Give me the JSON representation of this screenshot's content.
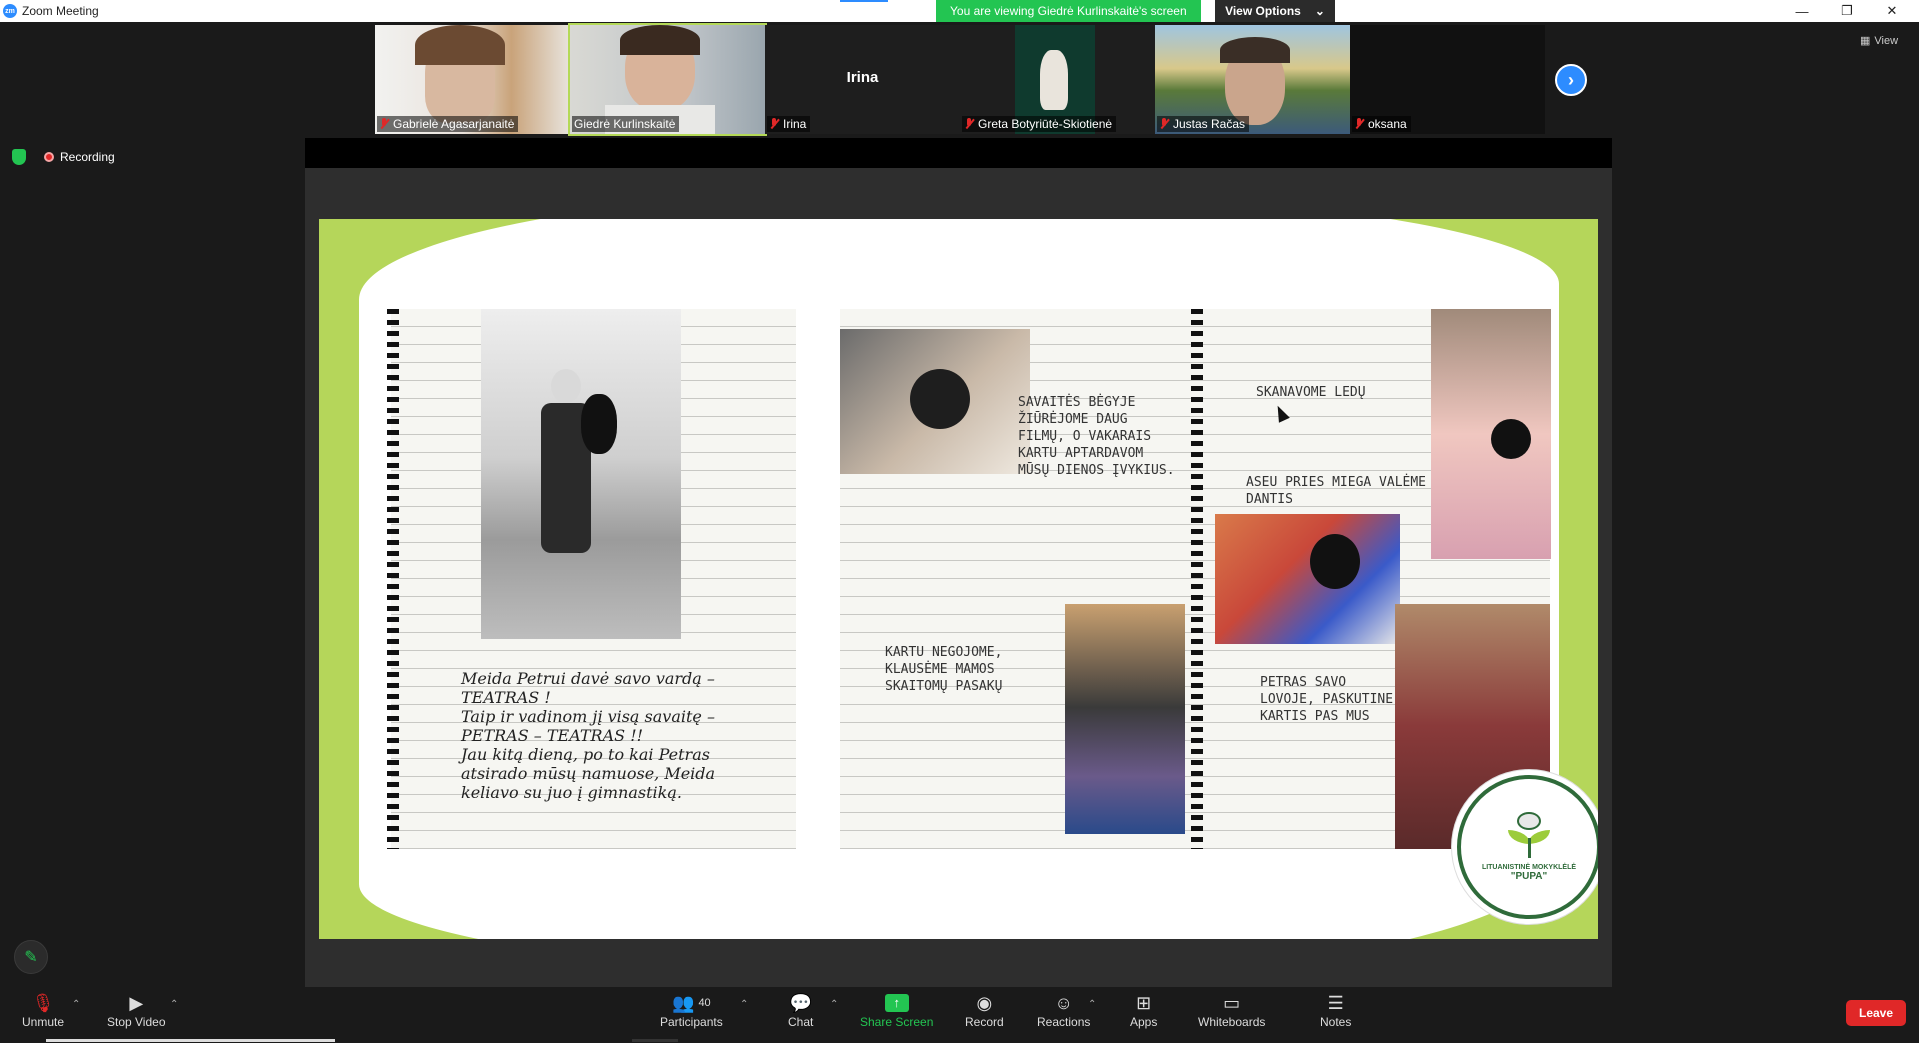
{
  "window": {
    "title": "Zoom Meeting",
    "logo_text": "zm",
    "banner": "You are viewing Giedrė Kurlinskaitė's screen",
    "view_options": "View Options",
    "minimize": "—",
    "restore": "❐",
    "close": "✕"
  },
  "gallery": {
    "participants": [
      {
        "name": "Gabrielė Agasarjanaitė",
        "muted": true
      },
      {
        "name": "Giedrė Kurlinskaitė",
        "muted": false
      },
      {
        "name": "Irina",
        "muted": true,
        "center_label": "Irina"
      },
      {
        "name": "Greta Botyriūtė-Skiotienė",
        "muted": true
      },
      {
        "name": "Justas Račas",
        "muted": true
      },
      {
        "name": "oksana",
        "muted": true
      }
    ],
    "next_arrow": "›",
    "view_label": "View"
  },
  "status": {
    "recording": "Recording"
  },
  "slide": {
    "left_page_text": "Meida Petrui davė savo vardą –\n  TEATRAS !\nTaip ir vadinom jį visą savaitę –\n  PETRAS – TEATRAS !!\nJau kitą dieną, po to kai Petras\natsirado mūsų namuose, Meida\nkeliavo su juo į gimnastiką.",
    "note1": "SAVAITĖS BĖGYJE\nŽIŪRĖJOME DAUG\nFILMŲ, O VAKARAIS\nKARTU APTARDAVOM\nMŪSŲ DIENOS ĮVYKIUS.",
    "note2": "SKANAVOME LEDŲ",
    "note3": "ASEU PRIES MIEGA VALĖME\nDANTIS",
    "note4": "KARTU NEGOJOME,\nKLAUSĖME MAMOS\nSKAITOMŲ PASAKŲ",
    "note5": "PETRAS SAVO\nLOVOJE, PASKUTINE\nKARTIS PAS MUS",
    "logo_line1": "LITUANISTINĖ MOKYKLĖLĖ",
    "logo_line2": "\"PUPA\""
  },
  "toolbar": {
    "unmute": "Unmute",
    "stop_video": "Stop Video",
    "participants": "Participants",
    "participants_count": "40",
    "chat": "Chat",
    "share_screen": "Share Screen",
    "record": "Record",
    "reactions": "Reactions",
    "apps": "Apps",
    "whiteboards": "Whiteboards",
    "notes": "Notes",
    "leave": "Leave"
  },
  "colors": {
    "banner_green": "#23c552",
    "slide_green": "#b5d65a",
    "leave_red": "#e02828",
    "accent_blue": "#2d8cff"
  }
}
